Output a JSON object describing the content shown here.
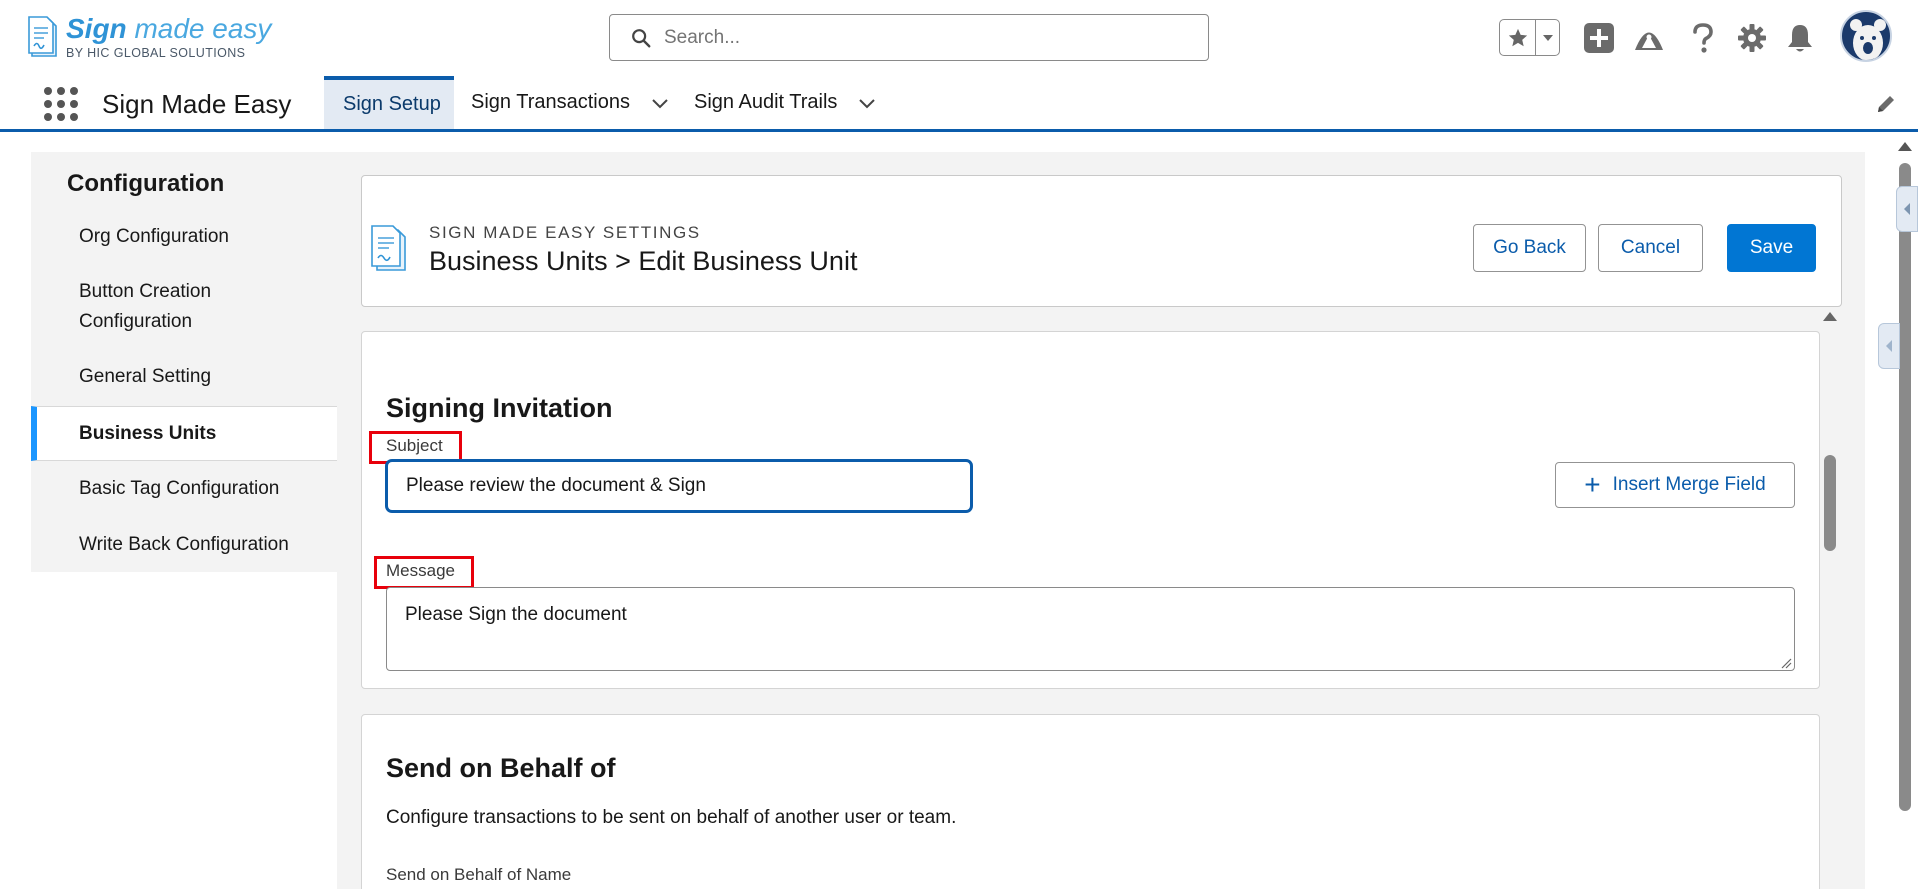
{
  "logo": {
    "brand_bold": "Sign",
    "brand_rest": " made easy",
    "byline": "BY HIC GLOBAL SOLUTIONS"
  },
  "search": {
    "placeholder": "Search..."
  },
  "header_icons": [
    "favorites-star-icon",
    "chevron-down-icon",
    "plus-icon",
    "trailhead-icon",
    "help-icon",
    "gear-icon",
    "bell-icon",
    "avatar"
  ],
  "app_nav": {
    "app_name": "Sign Made Easy",
    "tabs": [
      {
        "label": "Sign Setup",
        "active": true
      },
      {
        "label": "Sign Transactions",
        "active": false
      },
      {
        "label": "Sign Audit Trails",
        "active": false
      }
    ]
  },
  "sidebar": {
    "title": "Configuration",
    "items": [
      {
        "label": "Org Configuration"
      },
      {
        "label": "Button Creation Configuration"
      },
      {
        "label": "General Setting"
      },
      {
        "label": "Business Units",
        "active": true
      },
      {
        "label": "Basic Tag Configuration"
      },
      {
        "label": "Write Back Configuration"
      }
    ]
  },
  "page_header": {
    "eyebrow": "SIGN MADE EASY SETTINGS",
    "title": "Business Units > Edit Business Unit",
    "go_back": "Go Back",
    "cancel": "Cancel",
    "save": "Save"
  },
  "signing_invitation": {
    "title": "Signing Invitation",
    "subject_label": "Subject",
    "subject_value": "Please review the document & Sign",
    "insert_merge_field": "Insert Merge Field",
    "message_label": "Message",
    "message_value": "Please Sign the document"
  },
  "send_on_behalf": {
    "title": "Send on Behalf of",
    "description": "Configure transactions to be sent on behalf of another user or team.",
    "name_label": "Send on Behalf of Name"
  },
  "colors": {
    "brand_blue": "#0176d3",
    "nav_border": "#0b5cab",
    "active_tab_bg": "#e3eaf3",
    "highlight_red": "#e8000b",
    "logo_blue": "#2f93d6"
  }
}
